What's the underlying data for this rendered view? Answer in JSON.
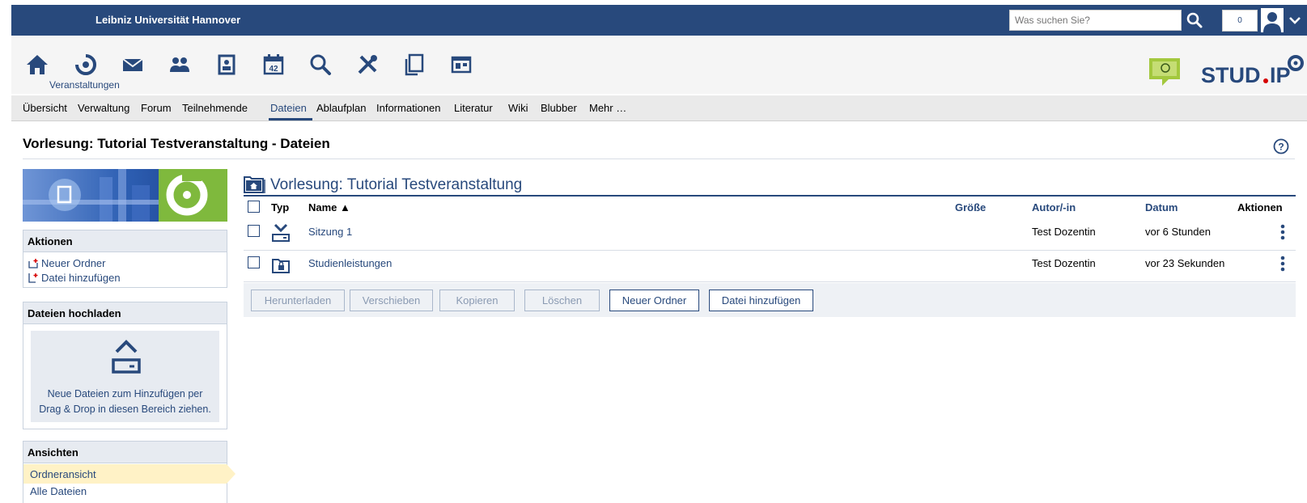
{
  "header": {
    "university": "Leibniz Universität Hannover",
    "search_placeholder": "Was suchen Sie?",
    "notification_count": "0"
  },
  "navbar": {
    "active_label": "Veranstaltungen",
    "icons": [
      "home-icon",
      "courses-icon",
      "mail-icon",
      "community-icon",
      "profile-icon",
      "calendar-icon",
      "search-icon",
      "tools-icon",
      "files-icon",
      "admin-icon"
    ],
    "calendar_day": "42"
  },
  "tabs": [
    "Übersicht",
    "Verwaltung",
    "Forum",
    "Teilnehmende",
    "Dateien",
    "Ablaufplan",
    "Informationen",
    "Literatur",
    "Wiki",
    "Blubber",
    "Mehr …"
  ],
  "active_tab": "Dateien",
  "page": {
    "title": "Vorlesung: Tutorial Testveranstaltung - Dateien"
  },
  "sidebar": {
    "actions": {
      "title": "Aktionen",
      "new_folder": "Neuer Ordner",
      "add_file": "Datei hinzufügen"
    },
    "upload": {
      "title": "Dateien hochladen",
      "text_line1": "Neue Dateien zum Hinzufügen per",
      "text_line2": "Drag & Drop in diesen Bereich ziehen."
    },
    "views": {
      "title": "Ansichten",
      "items": [
        "Ordneransicht",
        "Alle Dateien"
      ],
      "active": "Ordneransicht"
    }
  },
  "folder": {
    "title": "Vorlesung: Tutorial Testveranstaltung",
    "columns": {
      "type": "Typ",
      "name": "Name",
      "size": "Größe",
      "author": "Autor/-in",
      "date": "Datum",
      "actions": "Aktionen"
    },
    "sort_indicator": "▲",
    "rows": [
      {
        "type_icon": "download-folder-icon",
        "name": "Sitzung 1",
        "size": "",
        "author": "Test Dozentin",
        "date": "vor 6 Stunden"
      },
      {
        "type_icon": "locked-folder-icon",
        "name": "Studienleistungen",
        "size": "",
        "author": "Test Dozentin",
        "date": "vor 23 Sekunden"
      }
    ]
  },
  "buttons": {
    "download": "Herunterladen",
    "move": "Verschieben",
    "copy": "Kopieren",
    "delete": "Löschen",
    "new_folder": "Neuer Ordner",
    "add_file": "Datei hinzufügen"
  },
  "colors": {
    "brand": "#28497c",
    "active_view": "#fff2c6",
    "logo_green": "#7fb93d"
  }
}
